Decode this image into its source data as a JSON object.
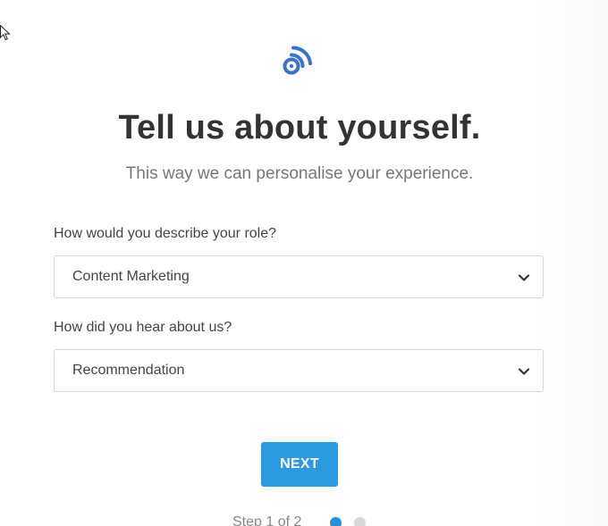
{
  "colors": {
    "brand": "#3d6fd0",
    "primary_button": "#2a9be0",
    "step_active": "#2a8fd8",
    "step_inactive": "#d9d9d9"
  },
  "header": {
    "logo_icon": "feed-signal-icon",
    "title": "Tell us about yourself.",
    "subtitle": "This way we can personalise your experience."
  },
  "form": {
    "role": {
      "label": "How would you describe your role?",
      "selected": "Content Marketing",
      "icon": "chevron-down-icon"
    },
    "source": {
      "label": "How did you hear about us?",
      "selected": "Recommendation",
      "icon": "chevron-down-icon"
    }
  },
  "actions": {
    "next_label": "NEXT"
  },
  "progress": {
    "step_label": "Step 1 of 2",
    "current_step": 1,
    "total_steps": 2
  }
}
